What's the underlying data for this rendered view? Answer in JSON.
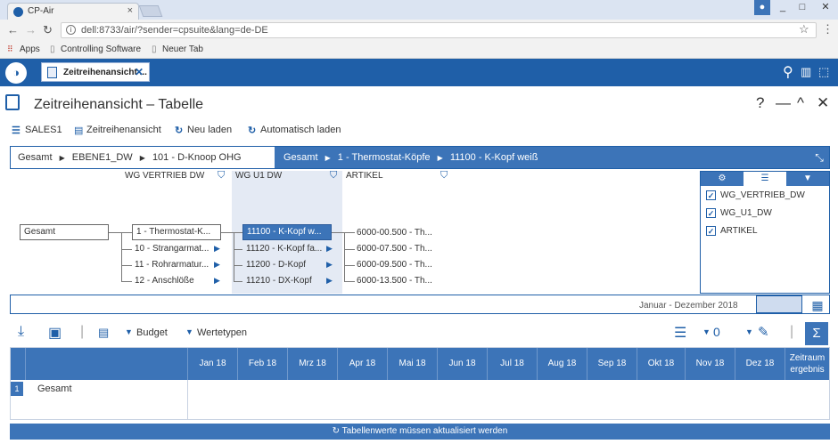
{
  "browser": {
    "tab_title": "CP-Air",
    "window_controls": [
      "_",
      "□",
      "✕"
    ],
    "url": "dell:8733/air/?sender=cpsuite&lang=de-DE",
    "bookmarks": [
      "Apps",
      "Controlling Software",
      "Neuer Tab"
    ]
  },
  "app": {
    "tab_label": "Zeitreihenansicht ...",
    "page_title": "Zeitreihenansicht – Tabelle",
    "title_controls": [
      "?",
      "—",
      "^",
      "✕"
    ],
    "toolbar": {
      "sales": "SALES1",
      "view": "Zeitreihenansicht",
      "reload": "Neu laden",
      "auto_reload": "Automatisch laden"
    },
    "breadcrumb_left": [
      "Gesamt",
      "EBENE1_DW",
      "101 - D-Knoop OHG"
    ],
    "breadcrumb_right": [
      "Gesamt",
      "1 - Thermostat-Köpfe",
      "11100 - K-Kopf weiß"
    ],
    "columns": [
      "WG VERTRIEB DW",
      "WG U1 DW",
      "ARTIKEL"
    ],
    "tree": {
      "root": "Gesamt",
      "level1": [
        "1 - Thermostat-K...",
        "10 - Strangarmat...",
        "11 - Rohrarmatur...",
        "12 - Anschlöße"
      ],
      "level2": [
        "11100 - K-Kopf w...",
        "11120 - K-Kopf fa...",
        "11200 - D-Kopf",
        "11210 - DX-Kopf"
      ],
      "level3": [
        "6000-00.500 - Th...",
        "6000-07.500 - Th...",
        "6000-09.500 - Th...",
        "6000-13.500 - Th..."
      ]
    },
    "side_panel": {
      "tabs": [
        "hierarchy-icon",
        "list-icon",
        "filter-icon"
      ],
      "checks": [
        {
          "label": "WG_VERTRIEB_DW",
          "checked": true
        },
        {
          "label": "WG_U1_DW",
          "checked": true
        },
        {
          "label": "ARTIKEL",
          "checked": true
        }
      ]
    },
    "timeline_label": "Januar - Dezember 2018",
    "toolbar2": {
      "budget": "Budget",
      "wertetypen": "Wertetypen"
    },
    "grid": {
      "months": [
        "Jan 18",
        "Feb 18",
        "Mrz 18",
        "Apr 18",
        "Mai 18",
        "Jun 18",
        "Jul 18",
        "Aug 18",
        "Sep 18",
        "Okt 18",
        "Nov 18",
        "Dez 18"
      ],
      "total_col": [
        "Zeitraum",
        "ergebnis"
      ],
      "row_num": "1",
      "row_label": "Gesamt"
    },
    "refresh_notice": "Tabellenwerte müssen aktualisiert werden"
  },
  "colors": {
    "brand": "#1f5fa8",
    "header": "#3c74b8"
  }
}
